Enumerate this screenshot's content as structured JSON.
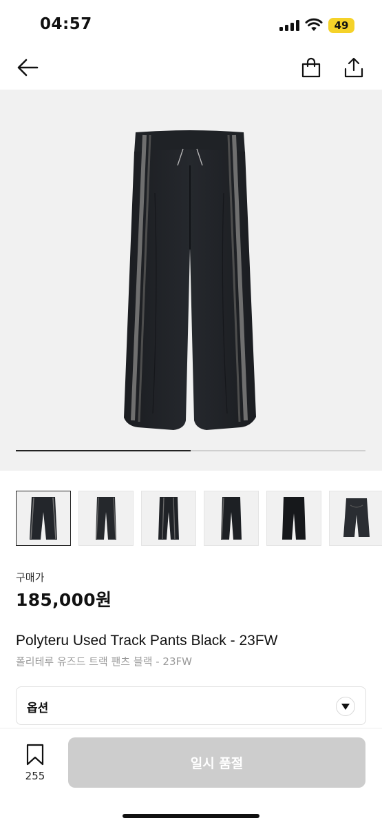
{
  "status_bar": {
    "time": "04:57",
    "battery": "49",
    "battery_color": "#f5d229",
    "icons": [
      "signal-icon",
      "wifi-icon",
      "battery-icon"
    ]
  },
  "nav": {
    "icons": [
      "back-arrow-icon",
      "shopping-bag-icon",
      "share-icon"
    ]
  },
  "gallery": {
    "image_name": "track-pants-photo",
    "progress_fraction": 0.5,
    "thumbnail_count": 6,
    "active_thumbnail": 0
  },
  "product": {
    "price_label": "구매가",
    "price": "185,000원",
    "title": "Polyteru Used Track Pants Black - 23FW",
    "title_ko": "폴리테루 유즈드 트랙 팬츠 블랙 - 23FW"
  },
  "option": {
    "label": "옵션",
    "icon": "caret-down-icon"
  },
  "bottom_bar": {
    "wish_icon": "bookmark-icon",
    "wish_count": "255",
    "action_label": "일시 품절",
    "action_color": "#cdcdcd"
  }
}
